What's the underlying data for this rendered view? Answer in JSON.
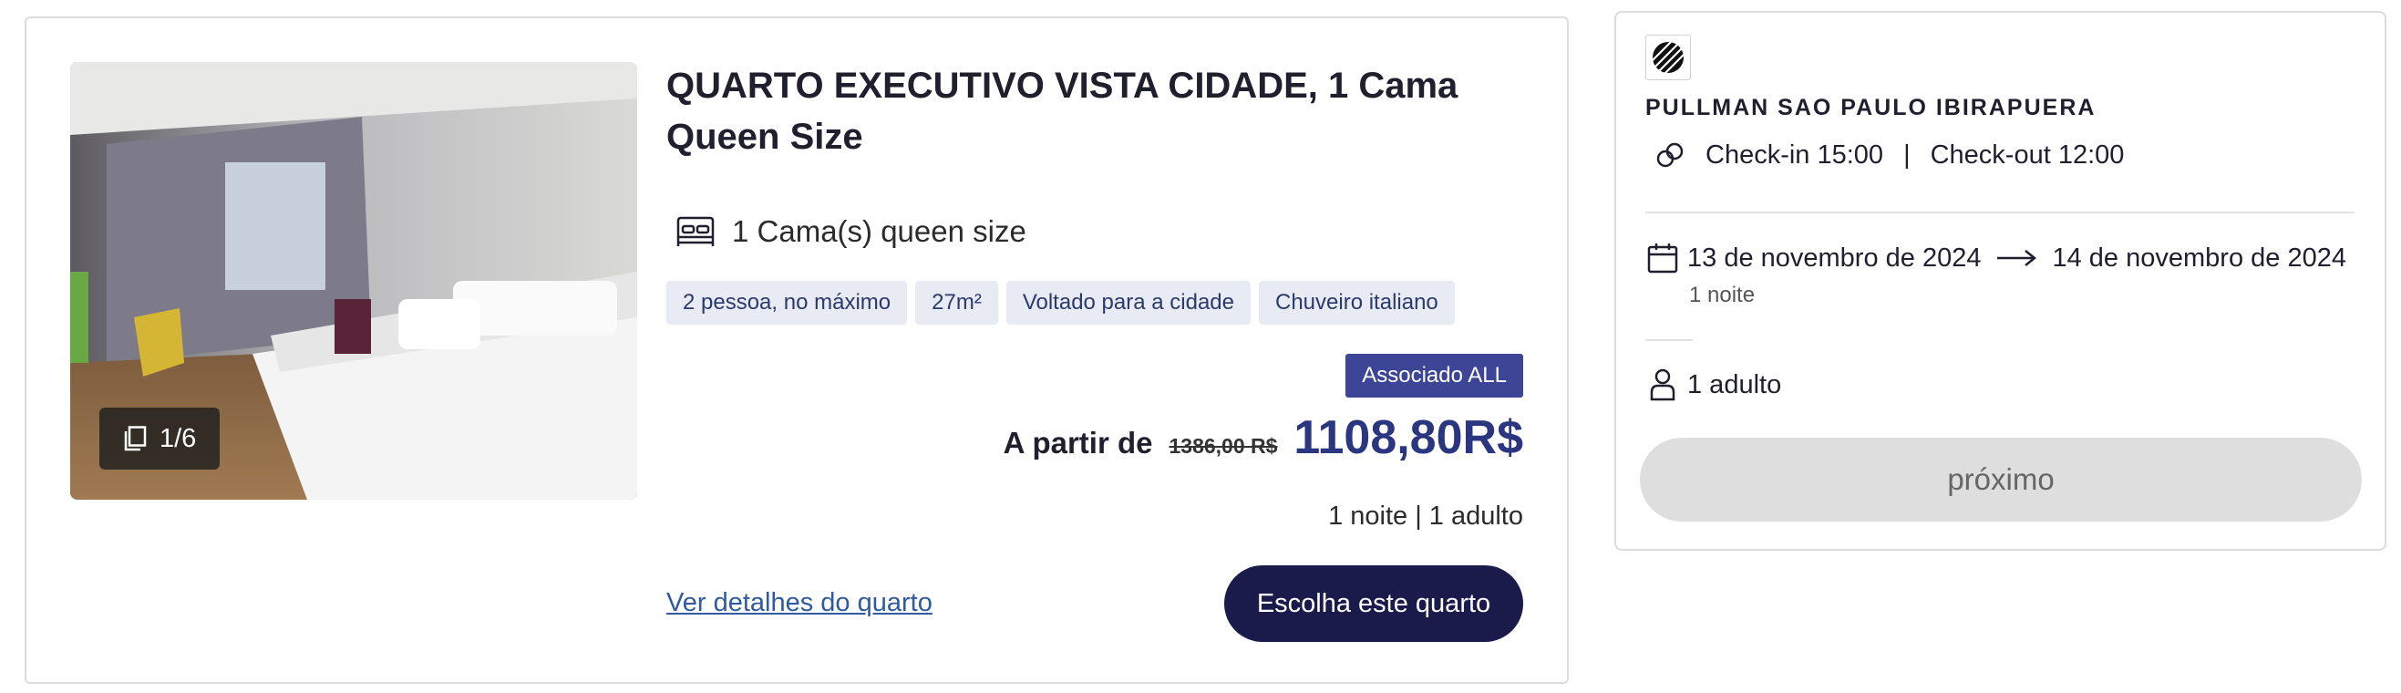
{
  "room": {
    "title": "QUARTO EXECUTIVO VISTA CIDADE, 1 Cama Queen Size",
    "photo_counter": "1/6",
    "bed_info": "1 Cama(s) queen size",
    "tags": [
      "2 pessoa, no máximo",
      "27m²",
      "Voltado para a cidade",
      "Chuveiro italiano"
    ],
    "member_badge": "Associado ALL",
    "price_from_label": "A partir de",
    "price_old": "1386,00 R$",
    "price_new": "1108,80R$",
    "stay_summary": "1 noite | 1 adulto",
    "details_link": "Ver detalhes do quarto",
    "choose_button": "Escolha este quarto"
  },
  "booking": {
    "hotel_name": "PULLMAN SAO PAULO IBIRAPUERA",
    "checkin": "Check-in 15:00",
    "separator": "|",
    "checkout": "Check-out 12:00",
    "date_from": "13 de novembro de 2024",
    "date_to": "14 de novembro de 2024",
    "nights": "1 noite",
    "guests": "1 adulto",
    "next_button": "próximo"
  },
  "colors": {
    "primary_dark": "#1a1b4b",
    "accent_blue": "#2b3680",
    "badge": "#3c4596",
    "tag_bg": "#e8ebf4",
    "disabled_button": "#dedede"
  }
}
